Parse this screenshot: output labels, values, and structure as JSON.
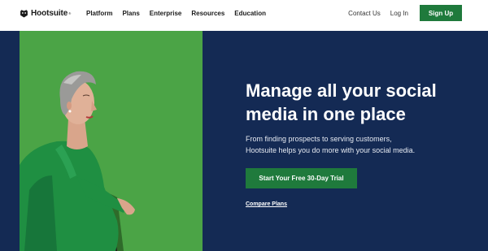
{
  "brand": {
    "name": "Hootsuite",
    "registered": "®",
    "logo_icon": "owl-icon"
  },
  "nav": {
    "items": [
      {
        "label": "Platform"
      },
      {
        "label": "Plans"
      },
      {
        "label": "Enterprise"
      },
      {
        "label": "Resources"
      },
      {
        "label": "Education"
      }
    ],
    "contact_label": "Contact Us",
    "login_label": "Log In",
    "signup_label": "Sign Up"
  },
  "hero": {
    "headline_line1": "Manage all your social",
    "headline_line2": "media in one place",
    "subtext_line1": "From finding prospects to serving customers,",
    "subtext_line2": "Hootsuite helps you do more with your social media.",
    "cta_label": "Start Your Free 30-Day Trial",
    "secondary_label": "Compare Plans"
  },
  "colors": {
    "accent_green": "#1f7a3c",
    "hero_navy": "#142a54",
    "photo_green": "#4ba446"
  }
}
